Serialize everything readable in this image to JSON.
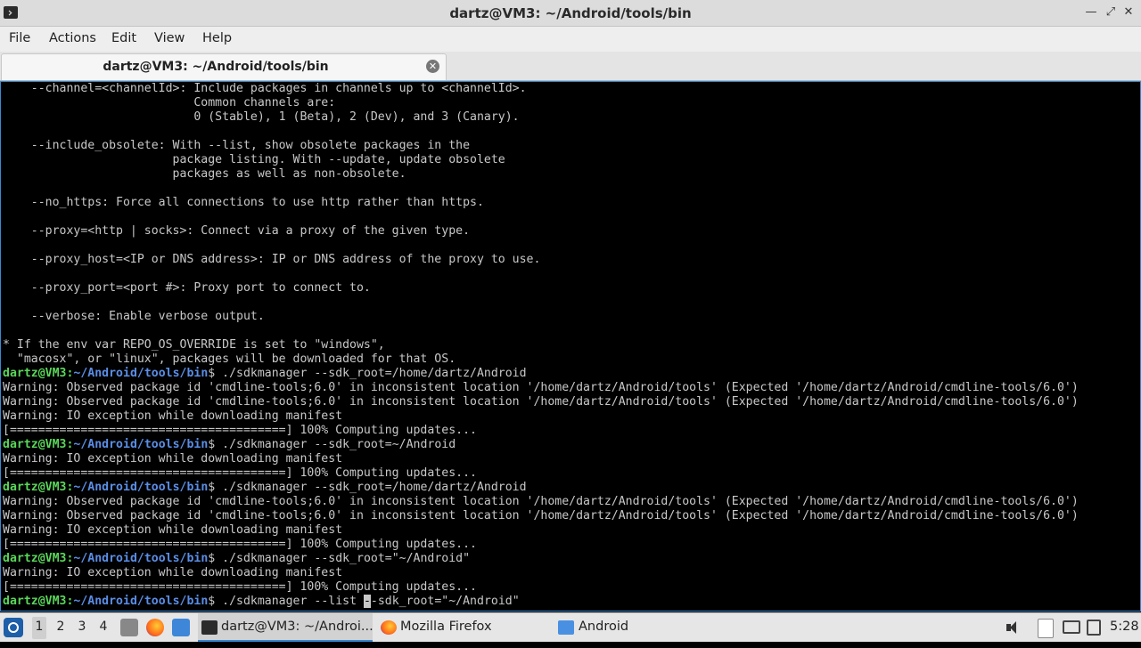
{
  "window": {
    "title": "dartz@VM3: ~/Android/tools/bin"
  },
  "menu": [
    "File",
    "Actions",
    "Edit",
    "View",
    "Help"
  ],
  "tab": {
    "label": "dartz@VM3: ~/Android/tools/bin",
    "close_icon": "close-circle-icon"
  },
  "terminal": {
    "lines": [
      {
        "text": "    --channel=<channelId>: Include packages in channels up to <channelId>."
      },
      {
        "text": "                           Common channels are:"
      },
      {
        "text": "                           0 (Stable), 1 (Beta), 2 (Dev), and 3 (Canary)."
      },
      {
        "text": ""
      },
      {
        "text": "    --include_obsolete: With --list, show obsolete packages in the"
      },
      {
        "text": "                        package listing. With --update, update obsolete"
      },
      {
        "text": "                        packages as well as non-obsolete."
      },
      {
        "text": ""
      },
      {
        "text": "    --no_https: Force all connections to use http rather than https."
      },
      {
        "text": ""
      },
      {
        "text": "    --proxy=<http | socks>: Connect via a proxy of the given type."
      },
      {
        "text": ""
      },
      {
        "text": "    --proxy_host=<IP or DNS address>: IP or DNS address of the proxy to use."
      },
      {
        "text": ""
      },
      {
        "text": "    --proxy_port=<port #>: Proxy port to connect to."
      },
      {
        "text": ""
      },
      {
        "text": "    --verbose: Enable verbose output."
      },
      {
        "text": ""
      },
      {
        "text": "* If the env var REPO_OS_OVERRIDE is set to \"windows\","
      },
      {
        "text": "  \"macosx\", or \"linux\", packages will be downloaded for that OS."
      },
      {
        "user": "dartz@VM3",
        "path": "~/Android/tools/bin",
        "cmd": "$ ./sdkmanager --sdk_root=/home/dartz/Android"
      },
      {
        "text": "Warning: Observed package id 'cmdline-tools;6.0' in inconsistent location '/home/dartz/Android/tools' (Expected '/home/dartz/Android/cmdline-tools/6.0')"
      },
      {
        "text": "Warning: Observed package id 'cmdline-tools;6.0' in inconsistent location '/home/dartz/Android/tools' (Expected '/home/dartz/Android/cmdline-tools/6.0')"
      },
      {
        "text": "Warning: IO exception while downloading manifest"
      },
      {
        "text": "[=======================================] 100% Computing updates..."
      },
      {
        "user": "dartz@VM3",
        "path": "~/Android/tools/bin",
        "cmd": "$ ./sdkmanager --sdk_root=~/Android"
      },
      {
        "text": "Warning: IO exception while downloading manifest"
      },
      {
        "text": "[=======================================] 100% Computing updates..."
      },
      {
        "user": "dartz@VM3",
        "path": "~/Android/tools/bin",
        "cmd": "$ ./sdkmanager --sdk_root=/home/dartz/Android"
      },
      {
        "text": "Warning: Observed package id 'cmdline-tools;6.0' in inconsistent location '/home/dartz/Android/tools' (Expected '/home/dartz/Android/cmdline-tools/6.0')"
      },
      {
        "text": "Warning: Observed package id 'cmdline-tools;6.0' in inconsistent location '/home/dartz/Android/tools' (Expected '/home/dartz/Android/cmdline-tools/6.0')"
      },
      {
        "text": "Warning: IO exception while downloading manifest"
      },
      {
        "text": "[=======================================] 100% Computing updates..."
      },
      {
        "user": "dartz@VM3",
        "path": "~/Android/tools/bin",
        "cmd": "$ ./sdkmanager --sdk_root=\"~/Android\""
      },
      {
        "text": "Warning: IO exception while downloading manifest"
      },
      {
        "text": "[=======================================] 100% Computing updates..."
      },
      {
        "user": "dartz@VM3",
        "path": "~/Android/tools/bin",
        "cmd_before_cursor": "$ ./sdkmanager --list ",
        "cursor_char": "-",
        "cmd_after_cursor": "-sdk_root=\"~/Android\""
      }
    ]
  },
  "taskbar": {
    "workspaces": [
      "1",
      "2",
      "3",
      "4"
    ],
    "active_workspace": "1",
    "quick_launch": [
      "files-icon",
      "firefox-icon",
      "show-desktop-icon"
    ],
    "tasks": [
      {
        "label": "dartz@VM3: ~/Androi...",
        "icon": "terminal-icon",
        "active": true
      },
      {
        "label": "Mozilla Firefox",
        "icon": "firefox-icon",
        "active": false
      },
      {
        "label": "Android",
        "icon": "folder-icon",
        "active": false
      }
    ],
    "tray": [
      "volume-icon",
      "clipboard-icon",
      "monitor-icon",
      "network-icon"
    ],
    "clock": "5:28"
  }
}
